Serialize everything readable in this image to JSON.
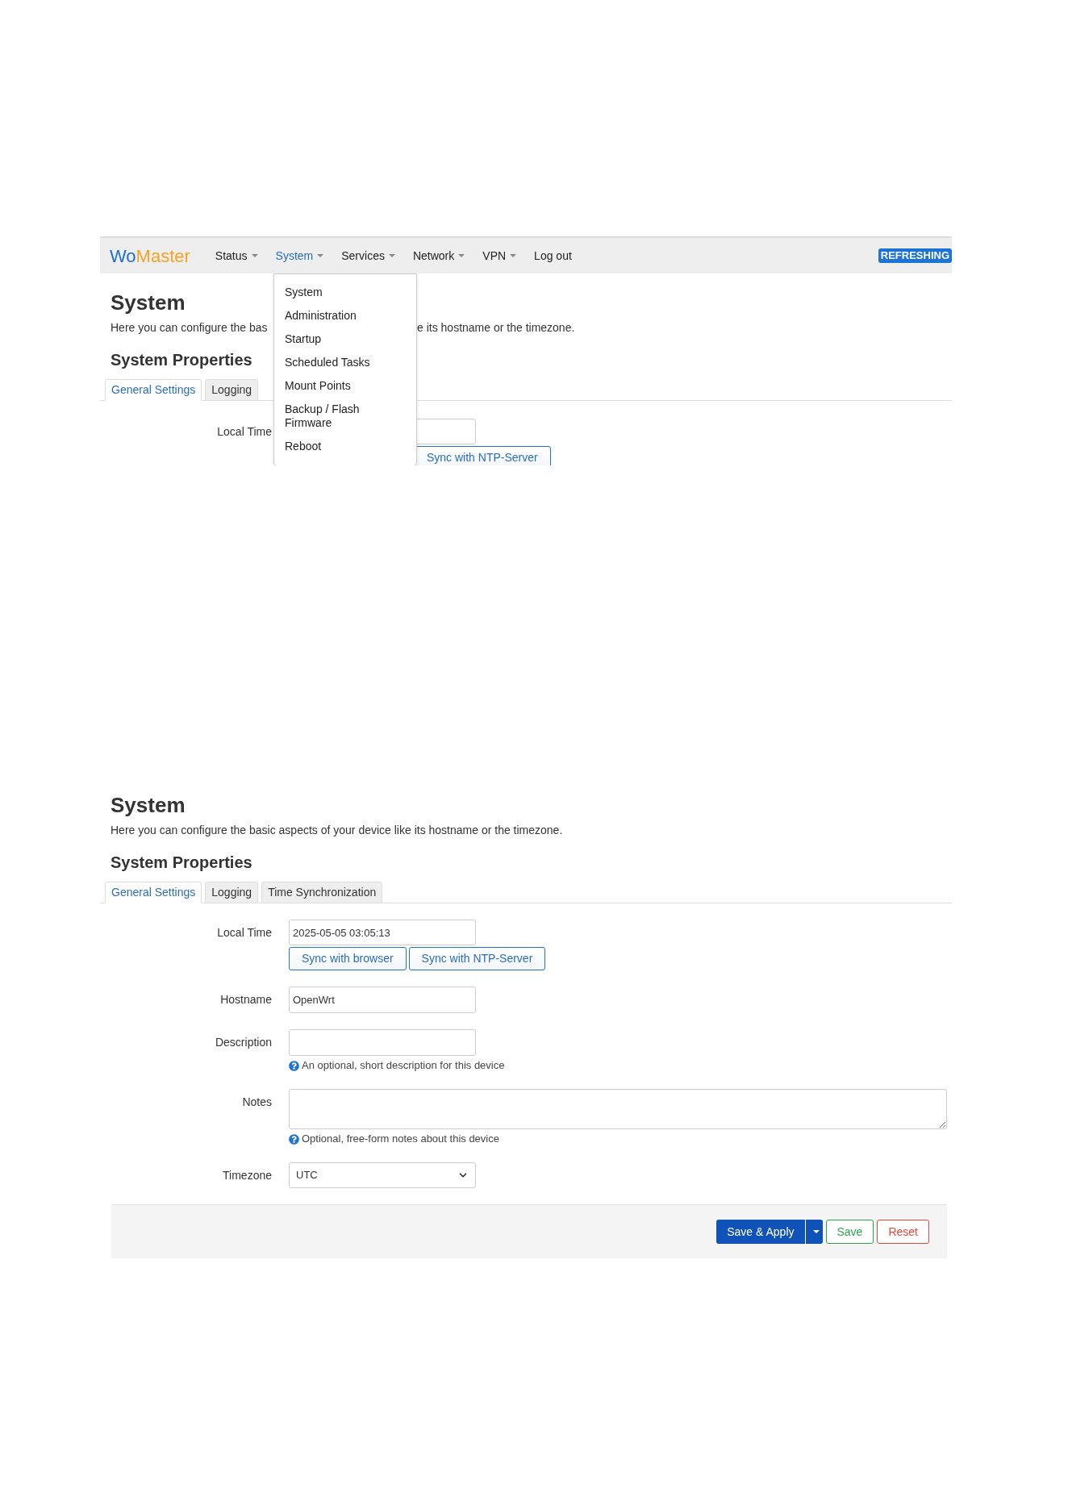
{
  "screenshots": [
    {
      "kind": "menu_open",
      "navbar": {
        "logo": {
          "first": "Wo",
          "second": "Master"
        },
        "items": [
          {
            "label": "Status",
            "caret": true,
            "selected": false
          },
          {
            "label": "System",
            "caret": true,
            "selected": true
          },
          {
            "label": "Services",
            "caret": true,
            "selected": false
          },
          {
            "label": "Network",
            "caret": true,
            "selected": false
          },
          {
            "label": "VPN",
            "caret": true,
            "selected": false
          },
          {
            "label": "Log out",
            "caret": false,
            "selected": false
          }
        ],
        "badge": "REFRESHING"
      },
      "dropdown": [
        "System",
        "Administration",
        "Startup",
        "Scheduled Tasks",
        "Mount Points",
        "Backup / Flash Firmware",
        "Reboot"
      ],
      "title": "System",
      "description_left": "Here you can configure the bas",
      "description_right": "e its hostname or the timezone.",
      "section_title": "System Properties",
      "tabs": [
        {
          "label": "General Settings",
          "selected": true
        },
        {
          "label": "Logging",
          "selected": false
        }
      ],
      "local_time_label": "Local Time",
      "ntp_button": "Sync with NTP-Server"
    },
    {
      "kind": "form",
      "title": "System",
      "description": "Here you can configure the basic aspects of your device like its hostname or the timezone.",
      "section_title": "System Properties",
      "tabs": [
        {
          "label": "General Settings",
          "selected": true
        },
        {
          "label": "Logging",
          "selected": false
        },
        {
          "label": "Time Synchronization",
          "selected": false
        }
      ],
      "fields": [
        {
          "kind": "time",
          "label": "Local Time",
          "value": "2025-05-05 03:05:13",
          "buttons": [
            "Sync with browser",
            "Sync with NTP-Server"
          ]
        },
        {
          "kind": "text",
          "label": "Hostname",
          "value": "OpenWrt"
        },
        {
          "kind": "text",
          "label": "Description",
          "help": "An optional, short description for this device"
        },
        {
          "kind": "textarea",
          "label": "Notes",
          "help": "Optional, free-form notes about this device"
        },
        {
          "kind": "select",
          "label": "Timezone",
          "value": "UTC"
        }
      ],
      "footer": {
        "apply": "Save & Apply",
        "save": "Save",
        "reset": "Reset"
      }
    }
  ]
}
